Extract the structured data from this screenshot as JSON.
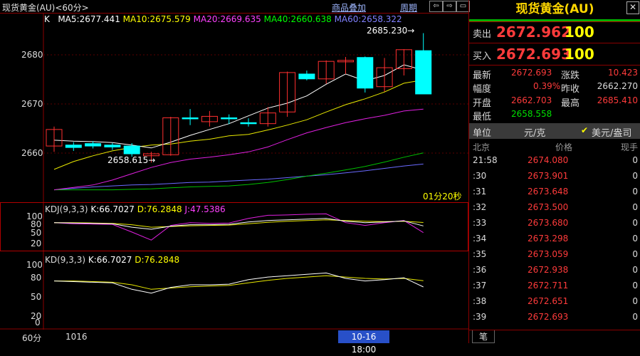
{
  "header": {
    "title": "现货黄金(AU)<60分>",
    "overlay_link": "商品叠加",
    "period_link": "周期",
    "nav": [
      "⇦",
      "⇨",
      "▭"
    ]
  },
  "ma": {
    "k": "K",
    "ma5": "MA5:2677.441",
    "ma10": "MA10:2675.579",
    "ma20": "MA20:2669.635",
    "ma40": "MA40:2660.638",
    "ma60": "MA60:2658.322"
  },
  "price_axis": [
    "2680",
    "2670",
    "2660"
  ],
  "annotations": {
    "high": "2685.230",
    "low": "2658.615",
    "countdown": "01分20秒"
  },
  "kdj": {
    "label": "KDJ(9,3,3)",
    "k": "K:66.7027",
    "d": "D:76.2848",
    "j": "J:47.5386",
    "axis": [
      "100",
      "80",
      "50",
      "20"
    ]
  },
  "kd": {
    "label": "KD(9,3,3)",
    "k": "K:66.7027",
    "d": "D:76.2848",
    "axis": [
      "100",
      "80",
      "50",
      "20",
      "0"
    ]
  },
  "bottom": {
    "period": "60分",
    "date1": "1016",
    "cursor": "10-16 18:00"
  },
  "panel": {
    "title": "现货黄金(AU)",
    "sell_label": "卖出",
    "sell_price": "2672.962",
    "sell_qty": "100",
    "buy_label": "买入",
    "buy_price": "2672.693",
    "buy_qty": "100",
    "stats": [
      {
        "l1": "最新",
        "v1": "2672.693",
        "l2": "涨跌",
        "v2": "10.423"
      },
      {
        "l1": "幅度",
        "v1": "0.39%",
        "l2": "昨收",
        "v2": "2662.270"
      },
      {
        "l1": "开盘",
        "v1": "2662.703",
        "l2": "最高",
        "v2": "2685.410"
      },
      {
        "l1": "最低",
        "v1": "2658.558",
        "l2": "",
        "v2": ""
      }
    ],
    "unit_label": "单位",
    "unit_value": "元/克",
    "unit_option": "美元/盎司",
    "trade_headers": [
      "北京",
      "价格",
      "现手"
    ],
    "trades": [
      {
        "time": "21:58",
        "price": "2674.080",
        "qty": "0"
      },
      {
        "time": ":30",
        "price": "2673.901",
        "qty": "0"
      },
      {
        "time": ":31",
        "price": "2673.648",
        "qty": "0"
      },
      {
        "time": ":32",
        "price": "2673.500",
        "qty": "0"
      },
      {
        "time": ":33",
        "price": "2673.680",
        "qty": "0"
      },
      {
        "time": ":34",
        "price": "2673.298",
        "qty": "0"
      },
      {
        "time": ":35",
        "price": "2673.059",
        "qty": "0"
      },
      {
        "time": ":36",
        "price": "2672.938",
        "qty": "0"
      },
      {
        "time": ":37",
        "price": "2672.711",
        "qty": "0"
      },
      {
        "time": ":38",
        "price": "2672.651",
        "qty": "0"
      },
      {
        "time": ":39",
        "price": "2672.693",
        "qty": "0"
      }
    ],
    "tab": "笔"
  },
  "chart_data": {
    "type": "candlestick",
    "ylim": [
      2652.5,
      2688.5
    ],
    "candles": [
      {
        "o": 2662.0,
        "c": 2665.4,
        "h": 2666.0,
        "l": 2660.8
      },
      {
        "o": 2662.2,
        "c": 2661.7,
        "h": 2662.8,
        "l": 2661.0
      },
      {
        "o": 2662.5,
        "c": 2662.0,
        "h": 2663.0,
        "l": 2661.5
      },
      {
        "o": 2662.2,
        "c": 2661.8,
        "h": 2662.6,
        "l": 2661.2
      },
      {
        "o": 2662.0,
        "c": 2660.4,
        "h": 2662.6,
        "l": 2659.8
      },
      {
        "o": 2660.0,
        "c": 2660.4,
        "h": 2660.8,
        "l": 2658.6
      },
      {
        "o": 2660.2,
        "c": 2667.8,
        "h": 2668.0,
        "l": 2660.0
      },
      {
        "o": 2667.8,
        "c": 2667.6,
        "h": 2669.6,
        "l": 2666.3
      },
      {
        "o": 2667.0,
        "c": 2668.1,
        "h": 2669.2,
        "l": 2666.0
      },
      {
        "o": 2667.8,
        "c": 2667.7,
        "h": 2668.5,
        "l": 2666.5
      },
      {
        "o": 2666.8,
        "c": 2666.6,
        "h": 2667.7,
        "l": 2666.0
      },
      {
        "o": 2666.6,
        "c": 2668.8,
        "h": 2670.0,
        "l": 2666.0
      },
      {
        "o": 2669.0,
        "c": 2677.1,
        "h": 2677.3,
        "l": 2668.0
      },
      {
        "o": 2676.8,
        "c": 2675.8,
        "h": 2677.5,
        "l": 2675.5
      },
      {
        "o": 2675.8,
        "c": 2679.4,
        "h": 2679.6,
        "l": 2674.8
      },
      {
        "o": 2679.3,
        "c": 2679.6,
        "h": 2680.3,
        "l": 2676.8
      },
      {
        "o": 2680.2,
        "c": 2673.9,
        "h": 2680.4,
        "l": 2673.0
      },
      {
        "o": 2674.2,
        "c": 2678.1,
        "h": 2680.1,
        "l": 2673.2
      },
      {
        "o": 2677.9,
        "c": 2681.8,
        "h": 2681.9,
        "l": 2676.5
      },
      {
        "o": 2681.6,
        "c": 2672.7,
        "h": 2685.2,
        "l": 2672.7
      }
    ],
    "ma5": [
      2663.2,
      2663.0,
      2662.9,
      2662.7,
      2662.2,
      2661.6,
      2662.8,
      2664.2,
      2665.4,
      2666.6,
      2668.2,
      2669.8,
      2670.8,
      2672.3,
      2674.7,
      2676.8,
      2675.4,
      2676.5,
      2678.7,
      2677.6
    ],
    "ma10": [
      2657.2,
      2658.8,
      2660.0,
      2661.0,
      2661.7,
      2662.2,
      2662.4,
      2663.0,
      2663.4,
      2664.1,
      2664.4,
      2665.3,
      2666.3,
      2667.4,
      2669.0,
      2670.5,
      2671.7,
      2673.1,
      2674.9,
      2675.6
    ],
    "ma20": [
      2653.0,
      2653.5,
      2654.0,
      2655.0,
      2656.3,
      2657.6,
      2658.6,
      2659.3,
      2659.7,
      2660.2,
      2660.8,
      2661.8,
      2663.3,
      2664.7,
      2665.8,
      2666.8,
      2667.6,
      2668.3,
      2669.2,
      2669.6
    ],
    "ma40": [
      2653.0,
      2653.0,
      2653.0,
      2653.0,
      2653.1,
      2653.2,
      2653.4,
      2653.6,
      2653.7,
      2653.8,
      2654.1,
      2654.5,
      2655.1,
      2655.8,
      2656.4,
      2657.1,
      2657.8,
      2658.7,
      2659.7,
      2660.6
    ],
    "ma60": [
      2653.0,
      2653.3,
      2653.6,
      2653.8,
      2654.0,
      2654.1,
      2654.3,
      2654.5,
      2654.6,
      2654.8,
      2655.0,
      2655.2,
      2655.5,
      2655.8,
      2656.1,
      2656.5,
      2656.9,
      2657.4,
      2657.9,
      2658.3
    ],
    "kdj_k": [
      76,
      75,
      74,
      73,
      63,
      57,
      66,
      70,
      70,
      71,
      78,
      82,
      84,
      86,
      88,
      80,
      76,
      78,
      81,
      66.7
    ],
    "kdj_d": [
      76,
      76,
      75,
      74,
      70,
      63,
      65,
      67,
      68,
      69,
      73,
      77,
      80,
      82,
      84,
      82,
      80,
      79,
      80,
      76.3
    ],
    "kdj_j": [
      76,
      73,
      72,
      71,
      49,
      26,
      68,
      76,
      74,
      75,
      88,
      97,
      98,
      100,
      101,
      76,
      68,
      76,
      82,
      47.5
    ]
  }
}
